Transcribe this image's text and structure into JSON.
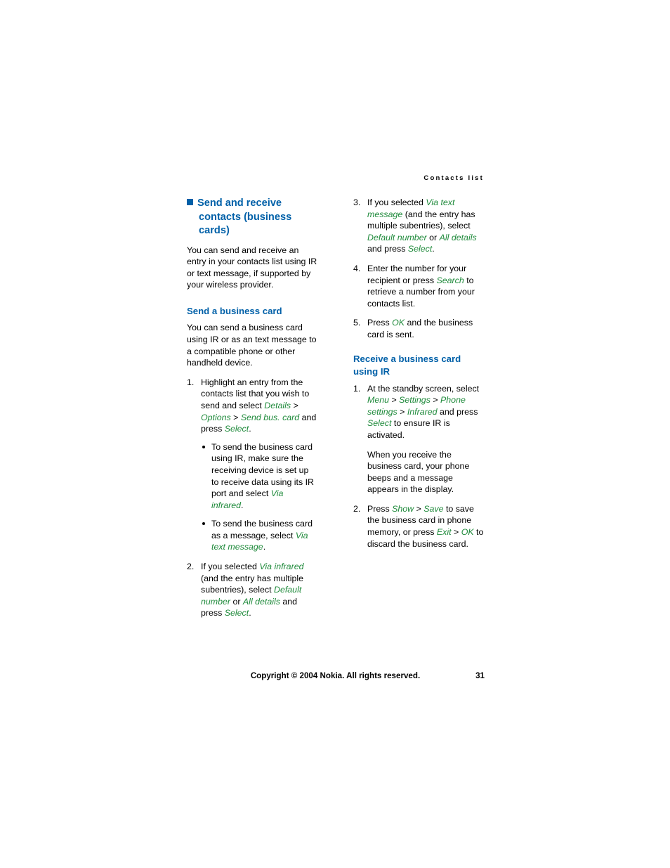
{
  "running_head": "Contacts list",
  "left_column": {
    "section_title_line1": "Send and receive",
    "section_title_line2": "contacts (business",
    "section_title_line3": "cards)",
    "intro": "You can send and receive an entry in your contacts list using IR or text message, if supported by your wireless provider.",
    "subsection_title": "Send a business card",
    "subsection_intro": "You can send a business card using IR or as an text message to a compatible phone or other handheld device.",
    "step1": {
      "num": "1.",
      "part1": "Highlight an entry from the contacts list that you wish to send and select ",
      "ui1": "Details",
      "part2": " > ",
      "ui2": "Options",
      "part3": " > ",
      "ui3": "Send bus. card",
      "part4": " and press ",
      "ui4": "Select",
      "part5": ".",
      "bullets": [
        {
          "part1": "To send the business card using IR, make sure the receiving device is set up to receive data using its IR port and select ",
          "ui1": "Via infrared",
          "part2": "."
        },
        {
          "part1": "To send the business card as a message, select ",
          "ui1": "Via text message",
          "part2": "."
        }
      ]
    },
    "step2": {
      "num": "2.",
      "part1": "If you selected ",
      "ui1": "Via infrared",
      "part2": " (and the entry has multiple subentries), select ",
      "ui2": "Default number",
      "part3": " or ",
      "ui3": "All details",
      "part4": " and press ",
      "ui4": "Select",
      "part5": "."
    }
  },
  "right_column": {
    "step3": {
      "num": "3.",
      "part1": "If you selected ",
      "ui1": "Via text message",
      "part2": " (and the entry has multiple subentries), select ",
      "ui2": "Default number",
      "part3": " or ",
      "ui3": "All details",
      "part4": " and press ",
      "ui4": "Select",
      "part5": "."
    },
    "step4": {
      "num": "4.",
      "part1": "Enter the number for your recipient or press ",
      "ui1": "Search",
      "part2": " to retrieve a number from your contacts list."
    },
    "step5": {
      "num": "5.",
      "part1": "Press ",
      "ui1": "OK",
      "part2": " and the business card is sent."
    },
    "subsection_title_line1": "Receive a business card",
    "subsection_title_line2": "using IR",
    "step1": {
      "num": "1.",
      "part1": "At the standby screen, select ",
      "ui1": "Menu",
      "part2": " > ",
      "ui2": "Settings",
      "part3": " > ",
      "ui3": "Phone settings",
      "part4": " > ",
      "ui4": "Infrared",
      "part5": " and press ",
      "ui5": "Select",
      "part6": " to ensure IR is activated.",
      "continuation": "When you receive the business card, your phone beeps and a message appears in the display."
    },
    "step2": {
      "num": "2.",
      "part1": "Press ",
      "ui1": "Show",
      "part2": " > ",
      "ui2": "Save",
      "part3": " to save the business card in phone memory, or press ",
      "ui3": "Exit",
      "part4": " > ",
      "ui4": "OK",
      "part5": " to discard the business card."
    }
  },
  "footer": {
    "copyright": "Copyright © 2004 Nokia. All rights reserved.",
    "page_number": "31"
  },
  "colors": {
    "heading_blue": "#0060a8",
    "ui_green": "#1f8a3b"
  }
}
